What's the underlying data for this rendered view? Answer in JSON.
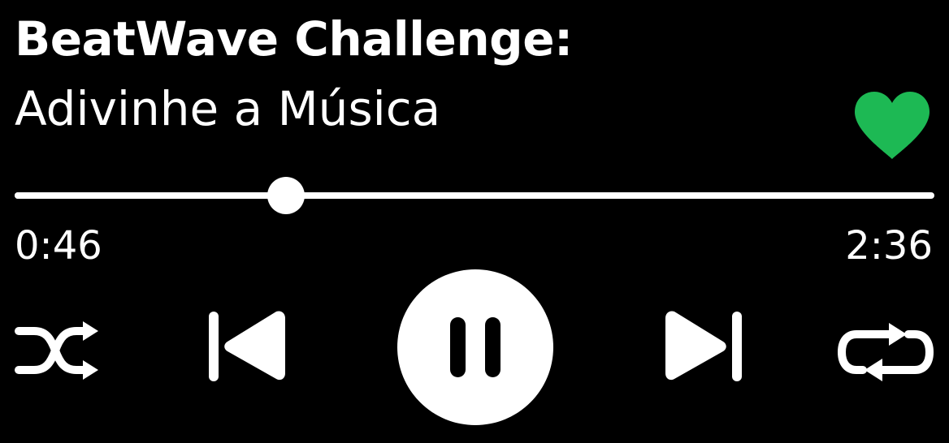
{
  "track": {
    "title": "BeatWave Challenge:",
    "subtitle": "Adivinhe a Música",
    "liked": true
  },
  "playback": {
    "elapsed": "0:46",
    "total": "2:36",
    "progress_fraction": 0.295,
    "state": "playing"
  },
  "icons": {
    "like": "heart-icon",
    "shuffle": "shuffle-icon",
    "previous": "skip-previous-icon",
    "pause": "pause-icon",
    "next": "skip-next-icon",
    "repeat": "repeat-icon"
  },
  "colors": {
    "background": "#000000",
    "foreground": "#ffffff",
    "accent": "#1db954"
  }
}
